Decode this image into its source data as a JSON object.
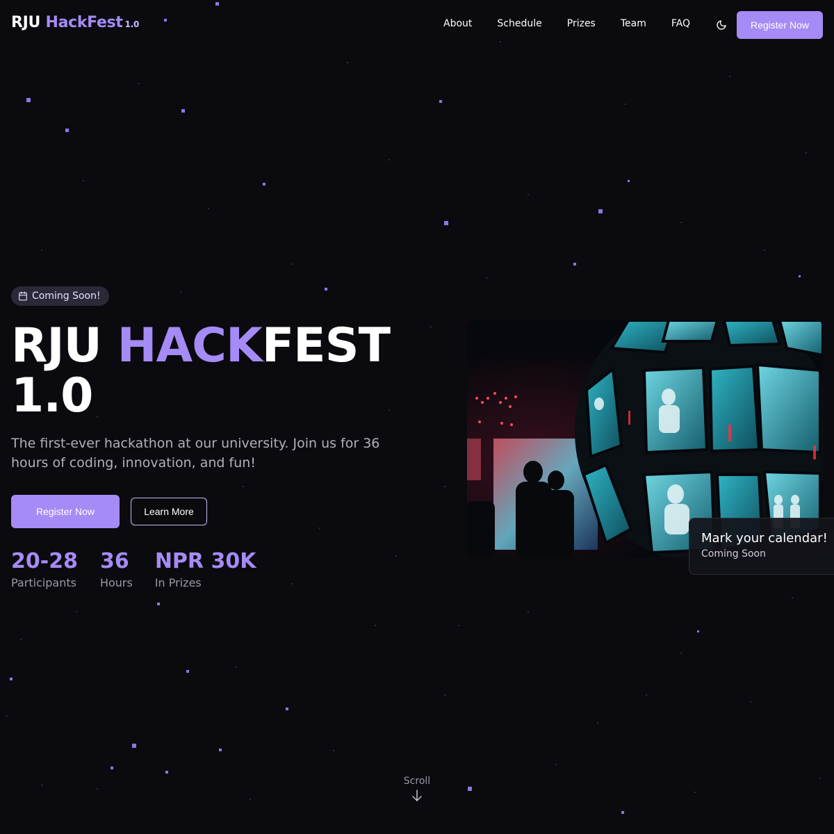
{
  "header": {
    "logo": {
      "part1": "RJU",
      "part2": "HackFest",
      "version": "1.0"
    },
    "nav": [
      "About",
      "Schedule",
      "Prizes",
      "Team",
      "FAQ"
    ],
    "theme_icon": "moon-icon",
    "register_label": "Register Now"
  },
  "hero": {
    "badge": {
      "icon": "calendar-icon",
      "label": "Coming Soon!"
    },
    "title": {
      "part1": "RJU",
      "highlight": "HACK",
      "part2": "FEST",
      "version": "1.0"
    },
    "subtitle": "The first-ever hackathon at our university. Join us for 36 hours of coding, innovation, and fun!",
    "primary_button": "Register Now",
    "secondary_button": "Learn More",
    "stats": [
      {
        "value": "20-28",
        "label": "Participants"
      },
      {
        "value": "36",
        "label": "Hours"
      },
      {
        "value": "NPR 30K",
        "label": "In Prizes"
      }
    ],
    "image_icon": "event-photo",
    "card": {
      "title": "Mark your calendar!",
      "subtitle": "Coming Soon"
    }
  },
  "scroll": {
    "label": "Scroll",
    "icon": "arrow-down-icon"
  },
  "colors": {
    "background": "#0b0a0f",
    "accent": "#a58bf5",
    "muted": "#9c98a8"
  }
}
